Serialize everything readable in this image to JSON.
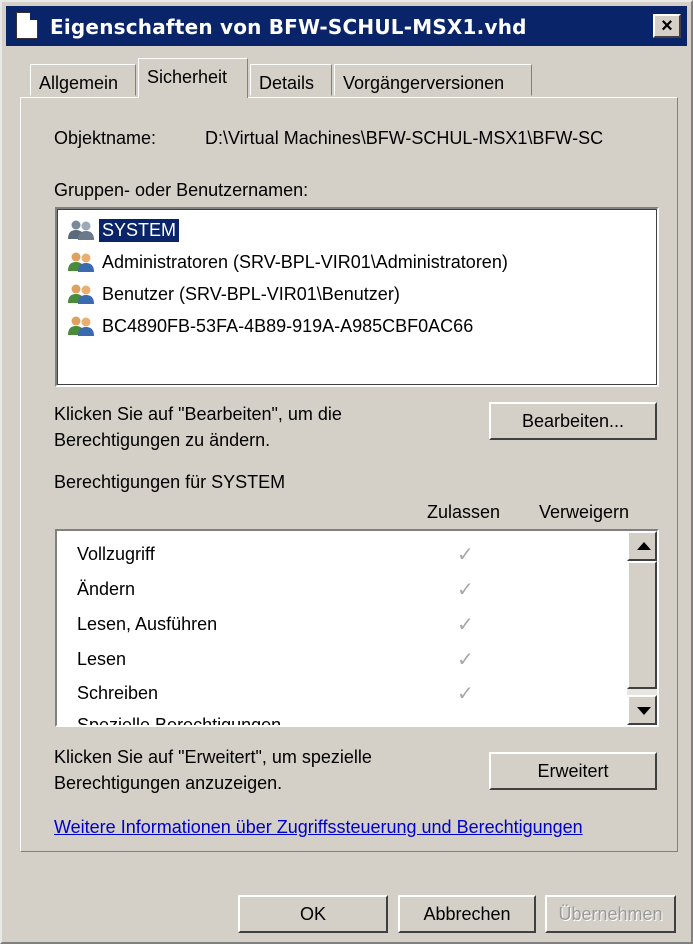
{
  "window": {
    "title": "Eigenschaften von BFW-SCHUL-MSX1.vhd",
    "close_label": "×"
  },
  "tabs": [
    {
      "label": "Allgemein"
    },
    {
      "label": "Sicherheit"
    },
    {
      "label": "Details"
    },
    {
      "label": "Vorgängerversionen"
    }
  ],
  "object": {
    "label": "Objektname:",
    "value": "D:\\Virtual Machines\\BFW-SCHUL-MSX1\\BFW-SC"
  },
  "groups": {
    "label": "Gruppen- oder Benutzernamen:",
    "items": [
      {
        "label": "SYSTEM",
        "selected": true
      },
      {
        "label": "Administratoren (SRV-BPL-VIR01\\Administratoren)"
      },
      {
        "label": "Benutzer (SRV-BPL-VIR01\\Benutzer)"
      },
      {
        "label": "BC4890FB-53FA-4B89-919A-A985CBF0AC66"
      }
    ],
    "icon": "users-icon"
  },
  "edit": {
    "hint_line1": "Klicken Sie auf \"Bearbeiten\", um die",
    "hint_line2": "Berechtigungen zu ändern.",
    "button_label": "Bearbeiten..."
  },
  "permissions": {
    "label": "Berechtigungen für SYSTEM",
    "col_allow": "Zulassen",
    "col_deny": "Verweigern",
    "rows": [
      {
        "name": "Vollzugriff",
        "allow": "✓"
      },
      {
        "name": "Ändern",
        "allow": "✓"
      },
      {
        "name": "Lesen, Ausführen",
        "allow": "✓"
      },
      {
        "name": "Lesen",
        "allow": "✓"
      },
      {
        "name": "Schreiben",
        "allow": "✓"
      },
      {
        "name": "Spezielle Berechtigungen",
        "allow": ""
      }
    ]
  },
  "advanced": {
    "hint_line1": "Klicken Sie auf \"Erweitert\", um spezielle",
    "hint_line2": "Berechtigungen anzuzeigen.",
    "button_label": "Erweitert"
  },
  "info_link": "Weitere Informationen über Zugriffssteuerung und Berechtigungen",
  "footer": {
    "ok": "OK",
    "cancel": "Abbrechen",
    "apply": "Übernehmen"
  },
  "colors": {
    "titlebar": "#0a246a",
    "face": "#d4d0c8",
    "selection": "#0a246a",
    "link": "#0000cc"
  }
}
